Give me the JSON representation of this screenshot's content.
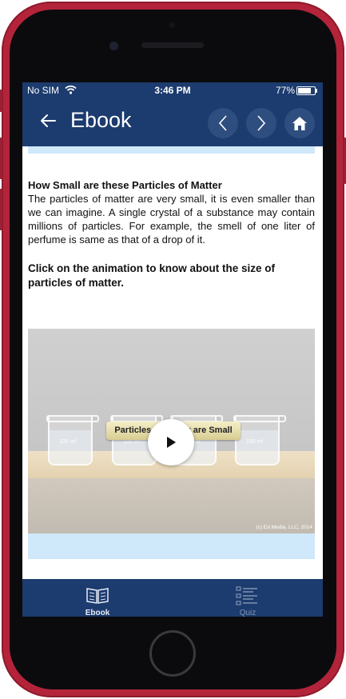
{
  "status_bar": {
    "carrier": "No SIM",
    "time": "3:46 PM",
    "battery": "77%"
  },
  "app_bar": {
    "title": "Ebook"
  },
  "content": {
    "heading": "How Small are these Particles of Matter",
    "paragraph": "The particles of matter are very small, it is even smaller than we can imagine. A single crystal of a substance may contain millions of particles. For example, the smell of one liter of perfume is same as that of a drop of it.",
    "instruction": "Click on the animation to know about the size of particles of matter."
  },
  "animation": {
    "banner": "Particles of Matter are Small",
    "beaker_label": "100 ml",
    "copyright": "(c) Ed Media, LLC, 2014"
  },
  "tabs": [
    {
      "label": "Ebook",
      "icon": "book-icon",
      "active": true
    },
    {
      "label": "Quiz",
      "icon": "list-icon",
      "active": false
    }
  ],
  "colors": {
    "navbar": "#1c3b6e",
    "light_strip": "#cfe8fa",
    "phone_frame": "#b3243a"
  }
}
